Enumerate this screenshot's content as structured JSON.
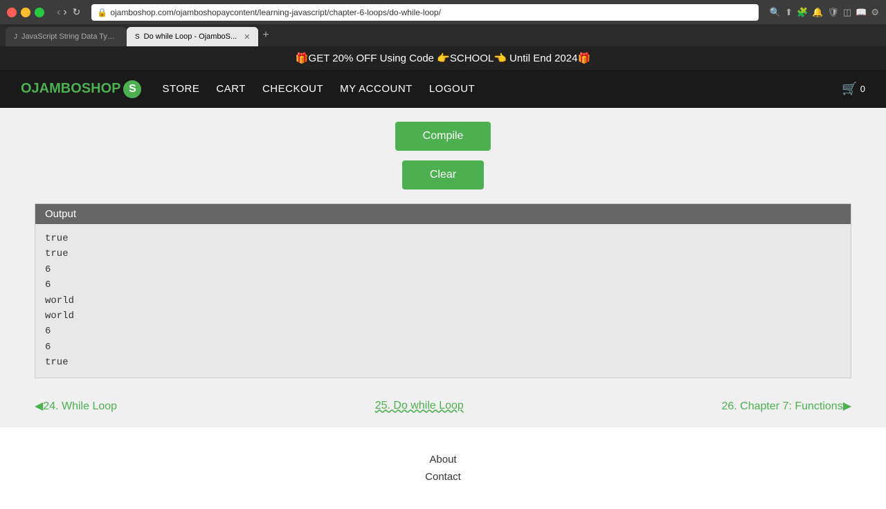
{
  "browser": {
    "tabs": [
      {
        "title": "JavaScript String Data Type - O",
        "favicon": "J",
        "active": false
      },
      {
        "title": "Do while Loop - OjamboS...",
        "favicon": "S",
        "active": true
      }
    ],
    "address": "ojamboshop.com/ojamboshopaycontent/learning-javascript/chapter-6-loops/do-while-loop/",
    "new_tab_label": "+"
  },
  "promo": {
    "text": "🎁GET 20% OFF Using Code 👉SCHOOL👈 Until End 2024🎁"
  },
  "nav": {
    "logo_text": "OJAMBOSHOP",
    "logo_letter": "S",
    "links": [
      {
        "label": "STORE",
        "active": false
      },
      {
        "label": "CART",
        "active": false
      },
      {
        "label": "CHECKOUT",
        "active": false
      },
      {
        "label": "MY ACCOUNT",
        "active": false
      },
      {
        "label": "LOGOUT",
        "active": false
      }
    ],
    "cart": {
      "icon": "🛒",
      "count": "0"
    }
  },
  "buttons": {
    "compile": "Compile",
    "clear": "Clear"
  },
  "output": {
    "header": "Output",
    "lines": [
      "true",
      "true",
      "6",
      "6",
      "world",
      "world",
      "6",
      "6",
      "true"
    ]
  },
  "bottom_nav": {
    "prev": {
      "label": "◀24. While Loop",
      "href": "#"
    },
    "current": {
      "label": "25. Do while Loop",
      "href": "#"
    },
    "next": {
      "label": "26. Chapter 7: Functions▶",
      "href": "#"
    }
  },
  "footer": {
    "links": [
      "About",
      "Contact"
    ]
  }
}
